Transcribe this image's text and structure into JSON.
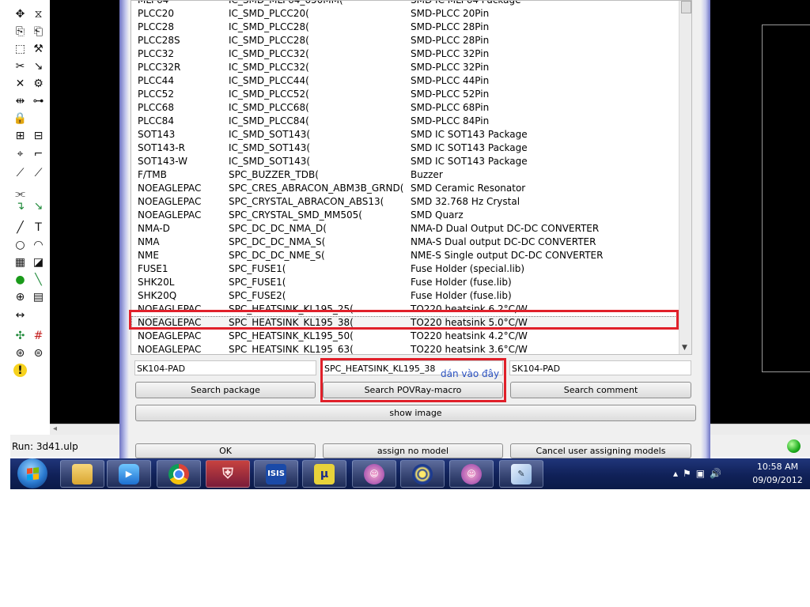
{
  "toolbar_icons": [
    [
      "move-icon",
      "✥"
    ],
    [
      "mirror-icon",
      "⧖"
    ],
    [
      "copy-icon",
      "⎘"
    ],
    [
      "paste-icon",
      "⎗"
    ],
    [
      "group-select-icon",
      "⬚"
    ],
    [
      "wrench-icon",
      "⚒"
    ],
    [
      "cut-icon",
      "✂"
    ],
    [
      "route-cut-icon",
      "↘"
    ],
    [
      "delete-icon",
      "✕"
    ],
    [
      "ratsnest-icon",
      "⚙"
    ],
    [
      "split-icon",
      "⇹"
    ],
    [
      "optimize-icon",
      "⊶"
    ],
    [
      "lock-icon",
      "🔒"
    ],
    [
      "blank-icon",
      ""
    ],
    [
      "name-icon",
      "⊞"
    ],
    [
      "value-icon",
      "⊟"
    ],
    [
      "smash-icon",
      "⌖"
    ],
    [
      "miter-icon",
      "⌐"
    ],
    [
      "split-line-icon",
      "⟋"
    ],
    [
      "change-icon",
      "⟋"
    ],
    [
      "pin-swap-icon",
      "⫘"
    ],
    [
      "blank2-icon",
      ""
    ],
    [
      "route-icon",
      "↴"
    ],
    [
      "ripup-icon",
      "↘"
    ],
    [
      "line-icon",
      "╱"
    ],
    [
      "text-icon",
      "T"
    ],
    [
      "circle-icon",
      "○"
    ],
    [
      "arc-icon",
      "◠"
    ],
    [
      "rect-icon",
      "▦"
    ],
    [
      "polygon-icon",
      "◪"
    ],
    [
      "via-icon",
      "●"
    ],
    [
      "signal-icon",
      "╲"
    ],
    [
      "hole-icon",
      "⊕"
    ],
    [
      "attribute-icon",
      "▤"
    ],
    [
      "dimension-icon",
      "↔"
    ],
    [
      "blank3-icon",
      ""
    ],
    [
      "auto-icon",
      "✣"
    ],
    [
      "grid-icon",
      "#"
    ],
    [
      "drc-icon",
      "⊛"
    ],
    [
      "errors-icon",
      "⊜"
    ],
    [
      "warning-icon",
      "!"
    ],
    [
      "blank4-icon",
      ""
    ]
  ],
  "list_rows": [
    [
      "MLF64",
      "IC_SMD_MLF64_650MM(",
      "SMD IC MLF64 Package"
    ],
    [
      "PLCC20",
      "IC_SMD_PLCC20(",
      "SMD-PLCC 20Pin"
    ],
    [
      "PLCC28",
      "IC_SMD_PLCC28(",
      "SMD-PLCC 28Pin"
    ],
    [
      "PLCC28S",
      "IC_SMD_PLCC28(",
      "SMD-PLCC 28Pin"
    ],
    [
      "PLCC32",
      "IC_SMD_PLCC32(",
      "SMD-PLCC 32Pin"
    ],
    [
      "PLCC32R",
      "IC_SMD_PLCC32(",
      "SMD-PLCC 32Pin"
    ],
    [
      "PLCC44",
      "IC_SMD_PLCC44(",
      "SMD-PLCC 44Pin"
    ],
    [
      "PLCC52",
      "IC_SMD_PLCC52(",
      "SMD-PLCC 52Pin"
    ],
    [
      "PLCC68",
      "IC_SMD_PLCC68(",
      "SMD-PLCC 68Pin"
    ],
    [
      "PLCC84",
      "IC_SMD_PLCC84(",
      "SMD-PLCC 84Pin"
    ],
    [
      "SOT143",
      "IC_SMD_SOT143(",
      "SMD IC SOT143 Package"
    ],
    [
      "SOT143-R",
      "IC_SMD_SOT143(",
      "SMD IC SOT143 Package"
    ],
    [
      "SOT143-W",
      "IC_SMD_SOT143(",
      "SMD IC SOT143 Package"
    ],
    [
      "F/TMB",
      "SPC_BUZZER_TDB(",
      "Buzzer"
    ],
    [
      "NOEAGLEPAC",
      "SPC_CRES_ABRACON_ABM3B_GRND(",
      "SMD Ceramic Resonator"
    ],
    [
      "NOEAGLEPAC",
      "SPC_CRYSTAL_ABRACON_ABS13(",
      "SMD 32.768 Hz Crystal"
    ],
    [
      "NOEAGLEPAC",
      "SPC_CRYSTAL_SMD_MM505(",
      "SMD Quarz"
    ],
    [
      "NMA-D",
      "SPC_DC_DC_NMA_D(",
      "NMA-D Dual Output DC-DC CONVERTER"
    ],
    [
      "NMA",
      "SPC_DC_DC_NMA_S(",
      "NMA-S Dual output DC-DC CONVERTER"
    ],
    [
      "NME",
      "SPC_DC_DC_NME_S(",
      "NME-S Single output DC-DC CONVERTER"
    ],
    [
      "FUSE1",
      "SPC_FUSE1(",
      "Fuse Holder (special.lib)"
    ],
    [
      "SHK20L",
      "SPC_FUSE1(",
      "Fuse Holder (fuse.lib)"
    ],
    [
      "SHK20Q",
      "SPC_FUSE2(",
      "Fuse Holder (fuse.lib)"
    ],
    [
      "NOEAGLEPAC",
      "SPC_HEATSINK_KL195_25(",
      "TO220 heatsink 6.2°C/W"
    ],
    [
      "NOEAGLEPAC",
      "SPC_HEATSINK_KL195_38(",
      "TO220 heatsink 5.0°C/W"
    ],
    [
      "NOEAGLEPAC",
      "SPC_HEATSINK_KL195_50(",
      "TO220 heatsink 4.2°C/W"
    ],
    [
      "NOEAGLEPAC",
      "SPC_HEATSINK_KL195_63(",
      "TO220 heatsink 3.6°C/W"
    ]
  ],
  "selected_row": 24,
  "fields": {
    "package": "SK104-PAD",
    "povray": "SPC_HEATSINK_KL195_38",
    "comment": "SK104-PAD"
  },
  "buttons": {
    "search_package": "Search package",
    "search_povray": "Search POVRay-macro",
    "search_comment": "Search comment",
    "show_image": "show image",
    "ok": "OK",
    "assign_no_model": "assign no model",
    "cancel": "Cancel user assigning models"
  },
  "annotation": "dán vào đây",
  "status_text": "Run: 3d41.ulp",
  "clock": {
    "time": "10:58 AM",
    "date": "09/09/2012"
  },
  "colors": {
    "highlight": "#e0202a",
    "annotation": "#2a50c0"
  }
}
